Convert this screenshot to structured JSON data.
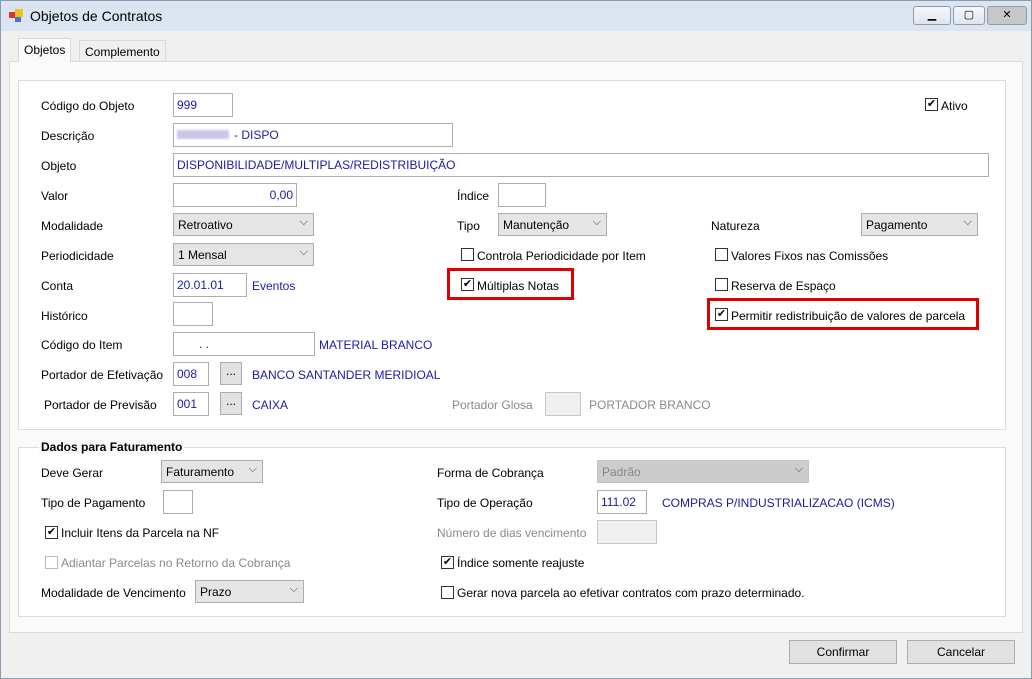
{
  "window": {
    "title": "Objetos de Contratos"
  },
  "tabs": [
    {
      "label": "Objetos"
    },
    {
      "label": "Complemento"
    }
  ],
  "fields": {
    "codigo_objeto": {
      "label": "Código do Objeto",
      "value": "999"
    },
    "ativo": {
      "label": "Ativo",
      "checked": true
    },
    "descricao": {
      "label": "Descrição",
      "value": "- DISPO"
    },
    "objeto": {
      "label": "Objeto",
      "value": "DISPONIBILIDADE/MULTIPLAS/REDISTRIBUIÇÃO"
    },
    "valor": {
      "label": "Valor",
      "value": "0,00"
    },
    "indice": {
      "label": "Índice",
      "value": ""
    },
    "modalidade": {
      "label": "Modalidade",
      "value": "Retroativo"
    },
    "tipo": {
      "label": "Tipo",
      "value": "Manutenção"
    },
    "natureza": {
      "label": "Natureza",
      "value": "Pagamento"
    },
    "periodicidade": {
      "label": "Periodicidade",
      "value": "1 Mensal"
    },
    "controla_periodicidade": {
      "label": "Controla Periodicidade por Item",
      "checked": false
    },
    "valores_fixos": {
      "label": "Valores Fixos nas Comissões",
      "checked": false
    },
    "conta": {
      "label": "Conta",
      "value": "20.01.01",
      "desc": "Eventos"
    },
    "multiplas_notas": {
      "label": "Múltiplas Notas",
      "checked": true
    },
    "reserva_espaco": {
      "label": "Reserva de Espaço",
      "checked": false
    },
    "historico": {
      "label": "Histórico",
      "value": ""
    },
    "permitir_redistribuicao": {
      "label": "Permitir redistribuição de valores de parcela",
      "checked": true
    },
    "codigo_item": {
      "label": "Código do Item",
      "value": ".   .",
      "desc": "MATERIAL BRANCO"
    },
    "portador_efetivacao": {
      "label": "Portador de Efetivação",
      "value": "008",
      "desc": "BANCO SANTANDER MERIDIOAL"
    },
    "portador_previsao": {
      "label": "Portador de Previsão",
      "value": "001",
      "desc": "CAIXA"
    },
    "portador_glosa": {
      "label": "Portador Glosa",
      "value": "",
      "desc": "PORTADOR BRANCO"
    }
  },
  "faturamento": {
    "title": "Dados para Faturamento",
    "deve_gerar": {
      "label": "Deve Gerar",
      "value": "Faturamento"
    },
    "forma_cobranca": {
      "label": "Forma de Cobrança",
      "value": "Padrão"
    },
    "tipo_pagamento": {
      "label": "Tipo de Pagamento",
      "value": ""
    },
    "tipo_operacao": {
      "label": "Tipo de Operação",
      "value": "111.02",
      "desc": "COMPRAS P/INDUSTRIALIZACAO (ICMS)"
    },
    "incluir_itens": {
      "label": "Incluir Itens da Parcela na NF",
      "checked": true
    },
    "numero_dias": {
      "label": "Número de dias vencimento",
      "value": ""
    },
    "adiantar_parcelas": {
      "label": "Adiantar Parcelas no Retorno da Cobrança",
      "checked": false
    },
    "indice_reajuste": {
      "label": "Índice somente reajuste",
      "checked": true
    },
    "modalidade_vencimento": {
      "label": "Modalidade de Vencimento",
      "value": "Prazo"
    },
    "gerar_nova_parcela": {
      "label": "Gerar nova parcela ao efetivar contratos com prazo determinado.",
      "checked": false
    }
  },
  "buttons": {
    "confirmar": "Confirmar",
    "cancelar": "Cancelar",
    "ellipsis": "..."
  },
  "colors": {
    "highlight": "#e00000",
    "value_text": "#1a1aa6"
  }
}
